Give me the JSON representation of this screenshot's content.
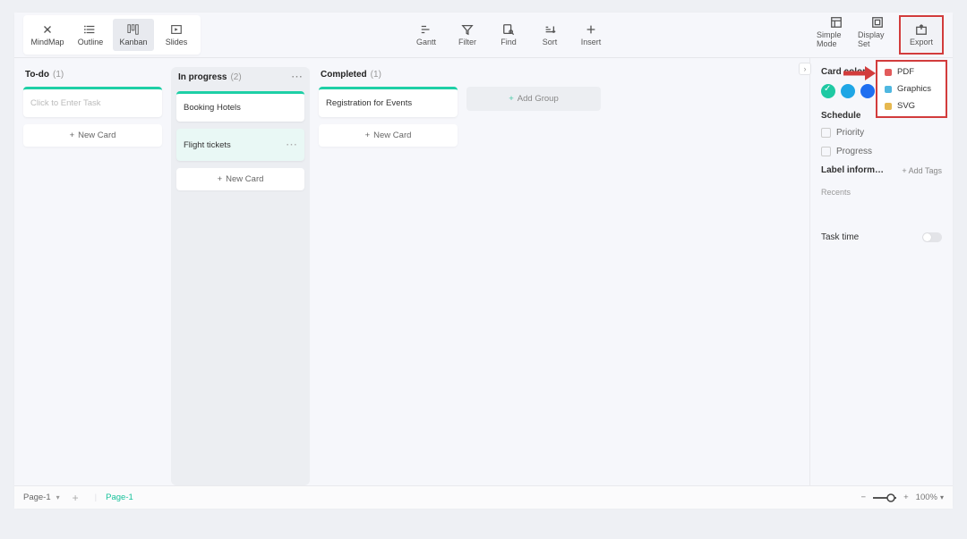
{
  "toolbar": {
    "views": {
      "mindmap": "MindMap",
      "outline": "Outline",
      "kanban": "Kanban",
      "slides": "Slides"
    },
    "center": {
      "gantt": "Gantt",
      "filter": "Filter",
      "find": "Find",
      "sort": "Sort",
      "insert": "Insert"
    },
    "right": {
      "simple": "Simple Mode",
      "display": "Display Set",
      "export": "Export"
    }
  },
  "export_menu": {
    "pdf": "PDF",
    "graphics": "Graphics",
    "svg": "SVG"
  },
  "board": {
    "columns": {
      "todo": {
        "title": "To-do",
        "count": "(1)",
        "new_card": "New Card",
        "placeholder": "Click to Enter Task"
      },
      "inprogress": {
        "title": "In progress",
        "count": "(2)",
        "new_card": "New Card",
        "cards": {
          "booking": "Booking Hotels",
          "flight": "Flight tickets"
        }
      },
      "completed": {
        "title": "Completed",
        "count": "(1)",
        "new_card": "New Card",
        "cards": {
          "reg": "Registration for Events"
        }
      }
    },
    "add_group": "Add Group"
  },
  "panel": {
    "card_color_label": "Card color",
    "colors": [
      "#1fc9a3",
      "#1fa6e5",
      "#1f6ff0"
    ],
    "schedule_label": "Schedule",
    "priority_label": "Priority",
    "progress_label": "Progress",
    "label_info": "Label inform…",
    "add_tags": "+ Add Tags",
    "recents": "Recents",
    "task_time": "Task time"
  },
  "footer": {
    "page_select": "Page-1",
    "page_active": "Page-1",
    "zoom_label": "100%"
  }
}
